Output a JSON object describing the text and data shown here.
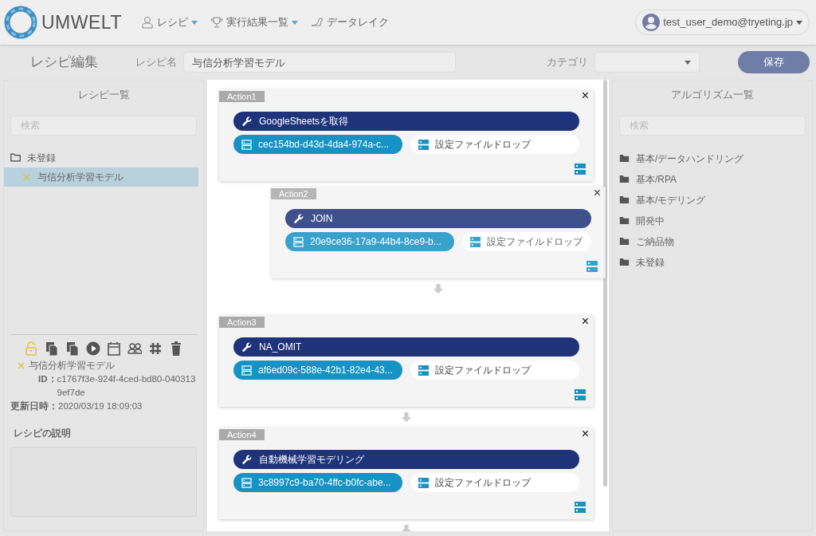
{
  "nav": {
    "brand": "UMWELT",
    "menu": [
      {
        "label": "レシピ",
        "kind": "recipe",
        "dropdown": true
      },
      {
        "label": "実行結果一覧",
        "kind": "results",
        "dropdown": true
      },
      {
        "label": "データレイク",
        "kind": "lake",
        "dropdown": false
      }
    ],
    "user": "test_user_demo@tryeting.jp"
  },
  "header": {
    "title": "レシピ編集",
    "recipe_name_label": "レシピ名",
    "recipe_name": "与信分析学習モデル",
    "category_label": "カテゴリ",
    "save_button": "保存"
  },
  "recipe_list": {
    "title": "レシピ一覧",
    "search": {
      "placeholder": "検索"
    },
    "tree": [
      {
        "label": "未登録",
        "kind": "folder",
        "selected": false,
        "children": [
          {
            "label": "与信分析学習モデル",
            "kind": "recipe",
            "selected": true
          }
        ]
      }
    ]
  },
  "recipe_detail": {
    "locked": false,
    "name": "与信分析学習モデル",
    "id_label": "ID：",
    "id": "c1767f3e-924f-4ced-bd80-0403139ef7de",
    "updated_label": "更新日時：",
    "updated": "2020/03/19 18:09:03",
    "description_label": "レシピの説明"
  },
  "actions": [
    {
      "title": "Action1",
      "close": "×",
      "name": "GoogleSheetsを取得",
      "data": "cec154bd-d43d-4da4-974a-c...",
      "drop": "設定ファイルドロップ",
      "dragging": false
    },
    {
      "title": "Action2",
      "close": "×",
      "name": "JOIN",
      "data": "20e9ce36-17a9-44b4-8ce9-b...",
      "drop": "設定ファイルドロップ",
      "dragging": true
    },
    {
      "title": "Action3",
      "close": "×",
      "name": "NA_OMIT",
      "data": "af6ed09c-588e-42b1-82e4-43...",
      "drop": "設定ファイルドロップ",
      "dragging": false
    },
    {
      "title": "Action4",
      "close": "×",
      "name": "自動機械学習モデリング",
      "data": "3c8997c9-ba70-4ffc-b0fc-abe...",
      "drop": "設定ファイルドロップ",
      "dragging": false
    }
  ],
  "algorithms": {
    "title": "アルゴリズム一覧",
    "search": {
      "placeholder": "検索"
    },
    "items": [
      {
        "label": "基本/データハンドリング",
        "kind": "folder"
      },
      {
        "label": "基本/RPA",
        "kind": "folder"
      },
      {
        "label": "基本/モデリング",
        "kind": "folder"
      },
      {
        "label": "開発中",
        "kind": "folder"
      },
      {
        "label": "ご納品物",
        "kind": "folder"
      },
      {
        "label": "未登録",
        "kind": "folder"
      }
    ]
  }
}
